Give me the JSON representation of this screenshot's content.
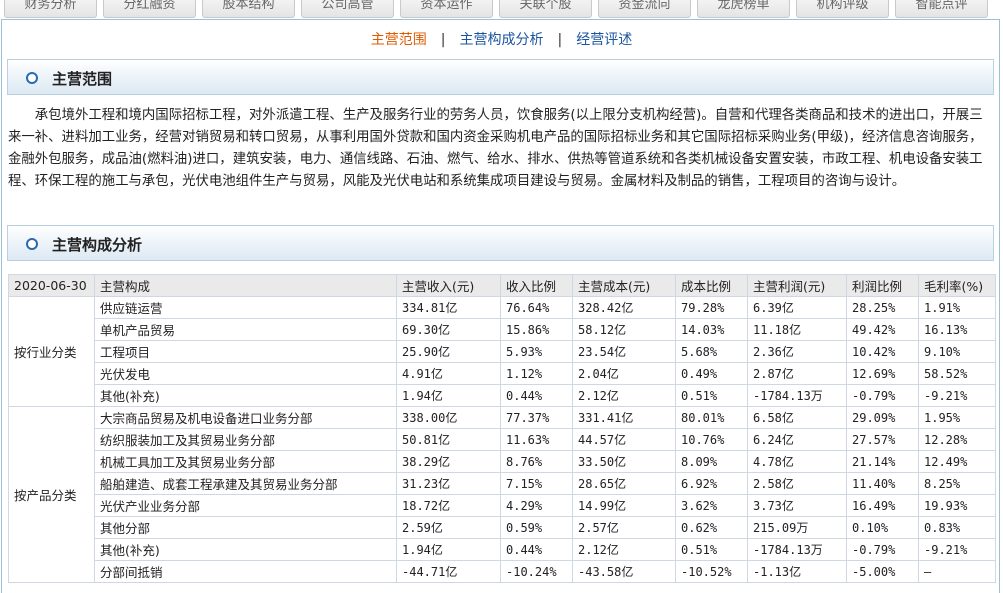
{
  "tabs": [
    "财务分析",
    "分红融资",
    "股本结构",
    "公司高管",
    "资本运作",
    "关联个股",
    "资金流向",
    "龙虎榜单",
    "机构评级",
    "智能点评"
  ],
  "subnav": {
    "items": [
      "主营范围",
      "主营构成分析",
      "经营评述"
    ],
    "separator": "|"
  },
  "scope": {
    "title": "主营范围",
    "text": "承包境外工程和境内国际招标工程，对外派遣工程、生产及服务行业的劳务人员，饮食服务(以上限分支机构经营)。自营和代理各类商品和技术的进出口，开展三来一补、进料加工业务，经营对销贸易和转口贸易，从事利用国外贷款和国内资金采购机电产品的国际招标业务和其它国际招标采购业务(甲级)，经济信息咨询服务，金融外包服务，成品油(燃料油)进口，建筑安装，电力、通信线路、石油、燃气、给水、排水、供热等管道系统和各类机械设备安置安装，市政工程、机电设备安装工程、环保工程的施工与承包，光伏电池组件生产与贸易，风能及光伏电站和系统集成项目建设与贸易。金属材料及制品的销售，工程项目的咨询与设计。"
  },
  "composition": {
    "title": "主营构成分析",
    "date": "2020-06-30",
    "headers": [
      "主营构成",
      "主营收入(元)",
      "收入比例",
      "主营成本(元)",
      "成本比例",
      "主营利润(元)",
      "利润比例",
      "毛利率(%)"
    ],
    "groups": [
      {
        "label": "按行业分类",
        "rows": [
          [
            "供应链运营",
            "334.81亿",
            "76.64%",
            "328.42亿",
            "79.28%",
            "6.39亿",
            "28.25%",
            "1.91%"
          ],
          [
            "单机产品贸易",
            "69.30亿",
            "15.86%",
            "58.12亿",
            "14.03%",
            "11.18亿",
            "49.42%",
            "16.13%"
          ],
          [
            "工程项目",
            "25.90亿",
            "5.93%",
            "23.54亿",
            "5.68%",
            "2.36亿",
            "10.42%",
            "9.10%"
          ],
          [
            "光伏发电",
            "4.91亿",
            "1.12%",
            "2.04亿",
            "0.49%",
            "2.87亿",
            "12.69%",
            "58.52%"
          ],
          [
            "其他(补充)",
            "1.94亿",
            "0.44%",
            "2.12亿",
            "0.51%",
            "-1784.13万",
            "-0.79%",
            "-9.21%"
          ]
        ]
      },
      {
        "label": "按产品分类",
        "rows": [
          [
            "大宗商品贸易及机电设备进口业务分部",
            "338.00亿",
            "77.37%",
            "331.41亿",
            "80.01%",
            "6.58亿",
            "29.09%",
            "1.95%"
          ],
          [
            "纺织服装加工及其贸易业务分部",
            "50.81亿",
            "11.63%",
            "44.57亿",
            "10.76%",
            "6.24亿",
            "27.57%",
            "12.28%"
          ],
          [
            "机械工具加工及其贸易业务分部",
            "38.29亿",
            "8.76%",
            "33.50亿",
            "8.09%",
            "4.78亿",
            "21.14%",
            "12.49%"
          ],
          [
            "船舶建造、成套工程承建及其贸易业务分部",
            "31.23亿",
            "7.15%",
            "28.65亿",
            "6.92%",
            "2.58亿",
            "11.40%",
            "8.25%"
          ],
          [
            "光伏产业业务分部",
            "18.72亿",
            "4.29%",
            "14.99亿",
            "3.62%",
            "3.73亿",
            "16.49%",
            "19.93%"
          ],
          [
            "其他分部",
            "2.59亿",
            "0.59%",
            "2.57亿",
            "0.62%",
            "215.09万",
            "0.10%",
            "0.83%"
          ],
          [
            "其他(补充)",
            "1.94亿",
            "0.44%",
            "2.12亿",
            "0.51%",
            "-1784.13万",
            "-0.79%",
            "-9.21%"
          ],
          [
            "分部间抵销",
            "-44.71亿",
            "-10.24%",
            "-43.58亿",
            "-10.52%",
            "-1.13亿",
            "-5.00%",
            "—"
          ]
        ]
      }
    ]
  }
}
